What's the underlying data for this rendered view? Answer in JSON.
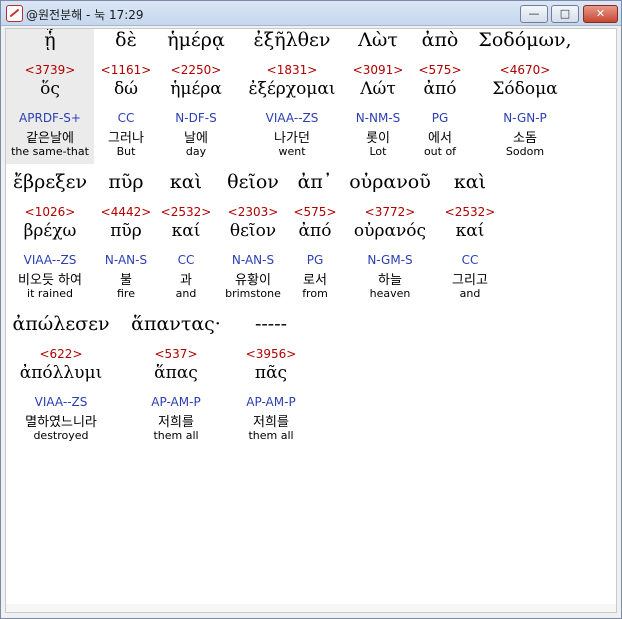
{
  "window": {
    "title": "@원전분해 - 눅 17:29",
    "min_label": "—",
    "max_label": "□",
    "close_label": "✕",
    "icon": "app-logo-icon"
  },
  "rows": [
    {
      "words": [
        {
          "greek": "ᾗ",
          "strong": "<3739>",
          "lemma": "ὅς",
          "morph": "APRDF-S+",
          "korean": "같은날에",
          "english": "the same-that"
        },
        {
          "greek": "δὲ",
          "strong": "<1161>",
          "lemma": "δώ",
          "morph": "CC",
          "korean": "그러나",
          "english": "But"
        },
        {
          "greek": "ἡμέρᾳ",
          "strong": "<2250>",
          "lemma": "ἡμέρα",
          "morph": "N-DF-S",
          "korean": "날에",
          "english": "day"
        },
        {
          "greek": "ἐξῆλθεν",
          "strong": "<1831>",
          "lemma": "ἐξέρχομαι",
          "morph": "VIAA--ZS",
          "korean": "나가던",
          "english": "went"
        },
        {
          "greek": "Λὼτ",
          "strong": "<3091>",
          "lemma": "Λώτ",
          "morph": "N-NM-S",
          "korean": "롯이",
          "english": "Lot"
        },
        {
          "greek": "ἀπὸ",
          "strong": "<575>",
          "lemma": "ἀπό",
          "morph": "PG",
          "korean": "에서",
          "english": "out of"
        },
        {
          "greek": "Σοδόμων,",
          "strong": "<4670>",
          "lemma": "Σόδομα",
          "morph": "N-GN-P",
          "korean": "소돔",
          "english": "Sodom"
        }
      ]
    },
    {
      "words": [
        {
          "greek": "ἔβρεξεν",
          "strong": "<1026>",
          "lemma": "βρέχω",
          "morph": "VIAA--ZS",
          "korean": "비오듯 하여",
          "english": "it rained"
        },
        {
          "greek": "πῦρ",
          "strong": "<4442>",
          "lemma": "πῦρ",
          "morph": "N-AN-S",
          "korean": "불",
          "english": "fire"
        },
        {
          "greek": "καὶ",
          "strong": "<2532>",
          "lemma": "καί",
          "morph": "CC",
          "korean": "과",
          "english": "and"
        },
        {
          "greek": "θεῖον",
          "strong": "<2303>",
          "lemma": "θεῖον",
          "morph": "N-AN-S",
          "korean": "유황이",
          "english": "brimstone"
        },
        {
          "greek": "ἀπ᾽",
          "strong": "<575>",
          "lemma": "ἀπό",
          "morph": "PG",
          "korean": "로서",
          "english": "from"
        },
        {
          "greek": "οὐρανοῦ",
          "strong": "<3772>",
          "lemma": "οὐρανός",
          "morph": "N-GM-S",
          "korean": "하늘",
          "english": "heaven"
        },
        {
          "greek": "καὶ",
          "strong": "<2532>",
          "lemma": "καί",
          "morph": "CC",
          "korean": "그리고",
          "english": "and"
        }
      ]
    },
    {
      "words": [
        {
          "greek": "ἀπώλεσεν",
          "strong": "<622>",
          "lemma": "ἀπόλλυμι",
          "morph": "VIAA--ZS",
          "korean": "멸하였느니라",
          "english": "destroyed"
        },
        {
          "greek": "ἅπαντας·",
          "strong": "<537>",
          "lemma": "ἅπας",
          "morph": "AP-AM-P",
          "korean": "저희를",
          "english": "them all"
        },
        {
          "greek": "-----",
          "strong": "<3956>",
          "lemma": "πᾶς",
          "morph": "AP-AM-P",
          "korean": "저희를",
          "english": "them all"
        }
      ]
    }
  ]
}
